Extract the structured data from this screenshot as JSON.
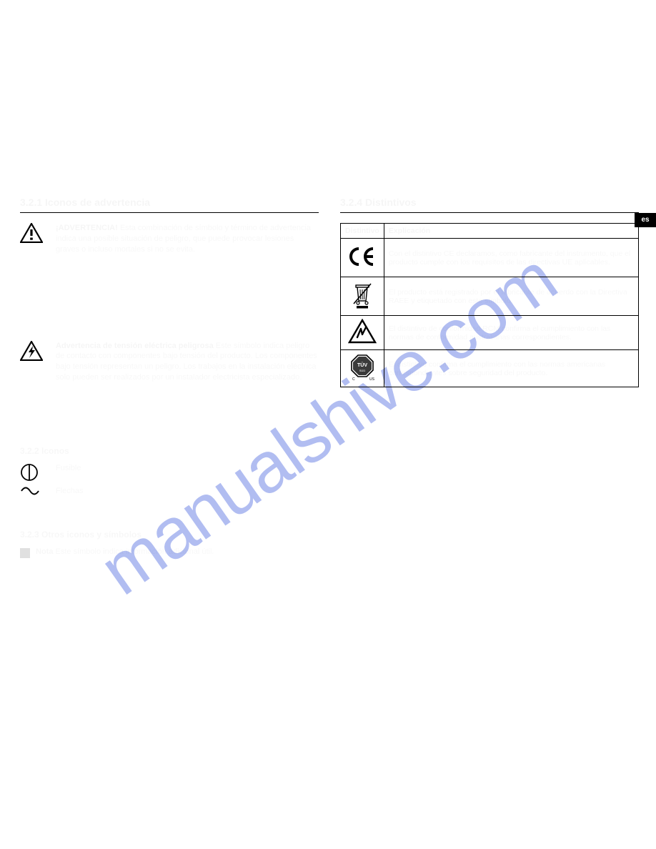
{
  "watermark": "manualshive.com",
  "lang_tab": "es",
  "left": {
    "heading": "3.2.1   Iconos de advertencia",
    "warn1": {
      "lead": "¡ADVERTENCIA!",
      "body": "Esta combinación de símbolo y término de advertencia indica una posible situación de peligro, que puede provocar lesiones graves o incluso mortales si no se evita."
    },
    "warn2": {
      "lead": "Advertencia de tensión eléctrica peligrosa",
      "body": "Este símbolo indica peligro de contacto con componentes bajo tensión del producto. Los componentes bajo tensión representan un peligro. Los trabajos en la instalación eléctrica solo pueden ser realizados por un instalador electricista especializado."
    },
    "sec2_h": "3.2.2   Iconos",
    "fuse": "Fusible",
    "arrow": "Flechas",
    "sec3_h": "3.2.3   Otros iconos y símbolos",
    "note_lead": "Nota",
    "note_body": "Este símbolo indica información adicional útil."
  },
  "right": {
    "heading": "3.2.4   Distintivos",
    "th1": "Distintivo",
    "th2": "Explicación",
    "ce": "Con el distintivo CE declaramos, como fabricante del instrumento, que el producto cumple con los requisitos de las directivas UE aplicables.",
    "weee": "El producto está registrado por el fabricante de acuerdo con la Directiva RAEE y etiquetado con este símbolo.",
    "rcm": "El distintivo de conformidad RCM confirma el cumplimiento con las normas de conformidad australianas correspondientes.",
    "tuv": "El distintivo confirma el cumplimiento con las normas americanas correspondientes sobre seguridad del producto."
  }
}
